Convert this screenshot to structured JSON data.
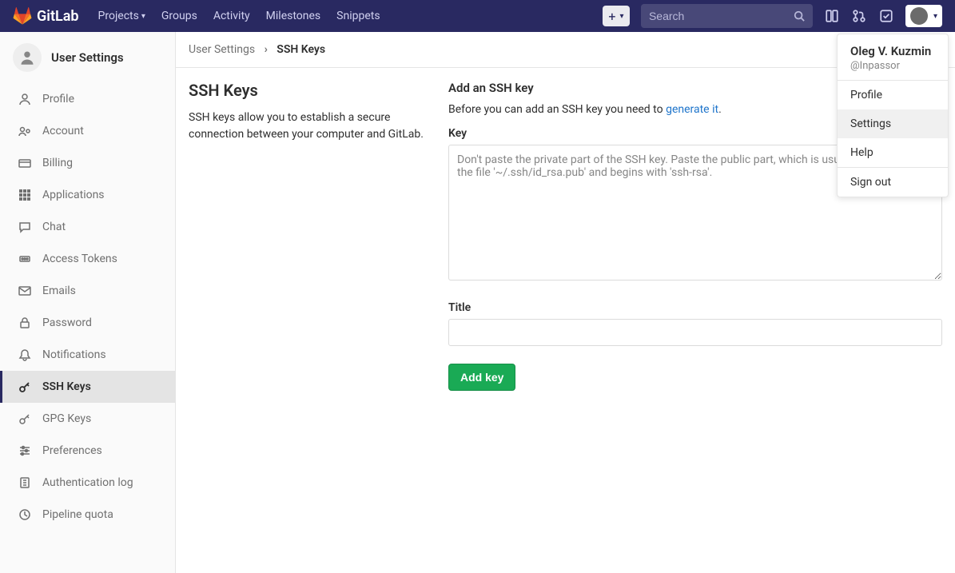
{
  "navbar": {
    "brand": "GitLab",
    "links": {
      "projects": "Projects",
      "groups": "Groups",
      "activity": "Activity",
      "milestones": "Milestones",
      "snippets": "Snippets"
    },
    "search_placeholder": "Search"
  },
  "sidebar": {
    "title": "User Settings",
    "items": [
      {
        "label": "Profile"
      },
      {
        "label": "Account"
      },
      {
        "label": "Billing"
      },
      {
        "label": "Applications"
      },
      {
        "label": "Chat"
      },
      {
        "label": "Access Tokens"
      },
      {
        "label": "Emails"
      },
      {
        "label": "Password"
      },
      {
        "label": "Notifications"
      },
      {
        "label": "SSH Keys"
      },
      {
        "label": "GPG Keys"
      },
      {
        "label": "Preferences"
      },
      {
        "label": "Authentication log"
      },
      {
        "label": "Pipeline quota"
      }
    ]
  },
  "breadcrumbs": {
    "parent": "User Settings",
    "current": "SSH Keys"
  },
  "main": {
    "heading": "SSH Keys",
    "description": "SSH keys allow you to establish a secure connection between your computer and GitLab.",
    "add_title": "Add an SSH key",
    "helper_prefix": "Before you can add an SSH key you need to ",
    "helper_link": "generate it",
    "helper_suffix": ".",
    "key_label": "Key",
    "key_placeholder": "Don't paste the private part of the SSH key. Paste the public part, which is usually contained in the file '~/.ssh/id_rsa.pub' and begins with 'ssh-rsa'.",
    "title_label": "Title",
    "submit": "Add key"
  },
  "user_menu": {
    "name": "Oleg V. Kuzmin",
    "handle": "@Inpassor",
    "items": {
      "profile": "Profile",
      "settings": "Settings",
      "help": "Help",
      "signout": "Sign out"
    }
  }
}
